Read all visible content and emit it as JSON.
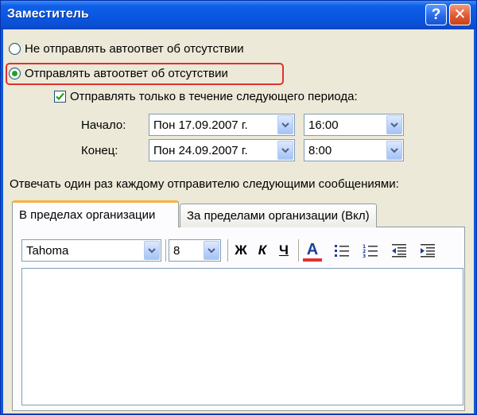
{
  "window": {
    "title": "Заместитель",
    "help_label": "?",
    "close_label": "✕"
  },
  "options": {
    "no_autoreply": "Не отправлять автоответ об отсутствии",
    "send_autoreply": "Отправлять автоответ об отсутствии",
    "selected": "send_autoreply"
  },
  "period": {
    "only_period_label": "Отправлять только в течение следующего периода:",
    "only_period_checked": true,
    "start_label": "Начало:",
    "end_label": "Конец:",
    "start_date": "Пон 17.09.2007 г.",
    "start_time": "16:00",
    "end_date": "Пон 24.09.2007 г.",
    "end_time": "8:00"
  },
  "reply": {
    "instruction": "Отвечать один раз каждому отправителю следующими сообщениями:",
    "tabs": [
      {
        "label": "В пределах организации",
        "active": true
      },
      {
        "label": "За пределами организации (Вкл)",
        "active": false
      }
    ]
  },
  "toolbar": {
    "font": "Tahoma",
    "size": "8",
    "bold": "Ж",
    "italic": "К",
    "underline": "Ч",
    "font_color": "A",
    "font_color_hex": "#e0312e"
  },
  "colors": {
    "titlebar": "#0a55e0",
    "dialog_bg": "#ece9d8",
    "highlight": "#e0312e",
    "radio_dot": "#21a121"
  },
  "icons": {
    "bullets": "bulleted-list-icon",
    "numbering": "numbered-list-icon",
    "outdent": "decrease-indent-icon",
    "indent": "increase-indent-icon",
    "dropdown": "chevron-down-icon"
  }
}
